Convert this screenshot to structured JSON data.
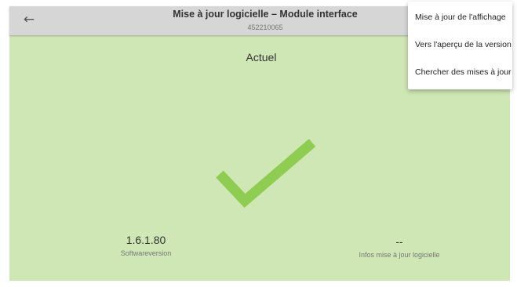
{
  "header": {
    "back_glyph": "←",
    "title": "Mise à jour logicielle – Module interface",
    "subtitle": "452210065"
  },
  "status": {
    "label": "Actuel",
    "icon": "checkmark-icon",
    "color": "#8fcc52"
  },
  "info": {
    "software_version": "1.6.1.80",
    "software_version_label": "Softwareversion",
    "update_info": "--",
    "update_info_label": "Infos mise à jour logicielle"
  },
  "menu": {
    "items": [
      "Mise à jour de l'affichage",
      "Vers l'aperçu de la version",
      "Chercher des mises à jour"
    ]
  }
}
